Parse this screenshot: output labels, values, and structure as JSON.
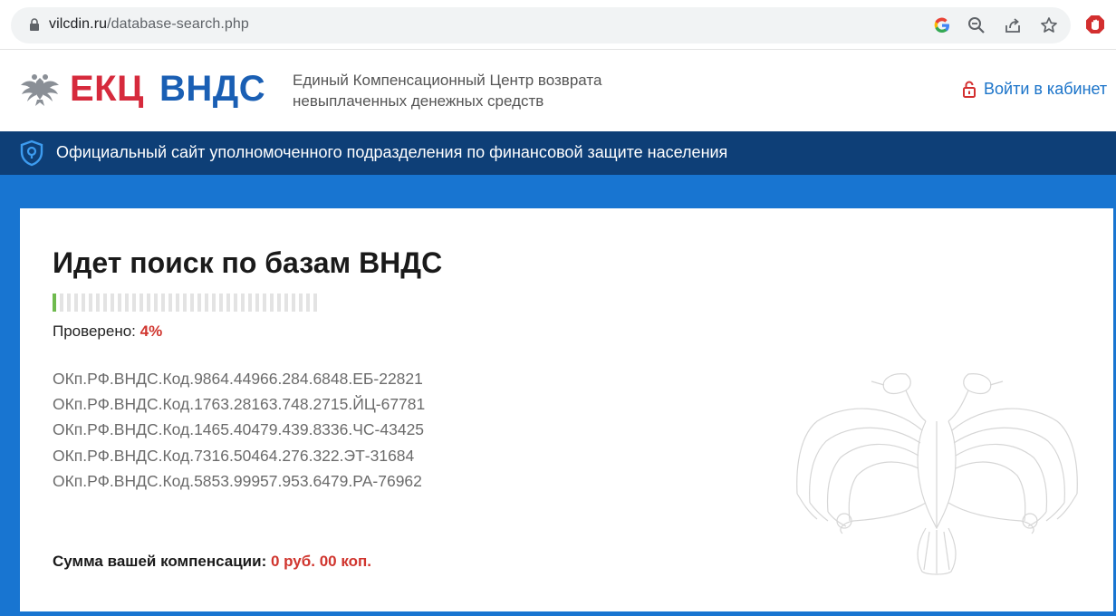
{
  "browser": {
    "url_host": "vilcdin.ru",
    "url_path": "/database-search.php",
    "icons": [
      "lock-icon",
      "google-icon",
      "zoom-icon",
      "share-icon",
      "star-icon",
      "extension-icon"
    ]
  },
  "header": {
    "brand_red": "ЕКЦ",
    "brand_blue": "ВНДС",
    "tagline_line1": "Единый Компенсационный Центр возврата",
    "tagline_line2": "невыплаченных денежных средств",
    "login_label": "Войти в кабинет"
  },
  "banner": {
    "text": "Официальный сайт уполномоченного подразделения по финансовой защите населения"
  },
  "search": {
    "title": "Идет поиск по базам ВНДС",
    "checked_label": "Проверено:",
    "checked_value": "4%",
    "progress_fraction": 0.04,
    "codes": [
      "ОКп.РФ.ВНДС.Код.9864.44966.284.6848.ЕБ-22821",
      "ОКп.РФ.ВНДС.Код.1763.28163.748.2715.ЙЦ-67781",
      "ОКп.РФ.ВНДС.Код.1465.40479.439.8336.ЧС-43425",
      "ОКп.РФ.ВНДС.Код.7316.50464.276.322.ЭТ-31684",
      "ОКп.РФ.ВНДС.Код.5853.99957.953.6479.РА-76962"
    ],
    "sum_label": "Сумма вашей компенсации:",
    "sum_value": "0 руб. 00 коп."
  },
  "colors": {
    "brand_red": "#d62a3c",
    "brand_blue": "#1a5fb4",
    "banner": "#0e3f77",
    "page_blue": "#1875d1",
    "progress_done": "#6fba4e",
    "accent_red": "#d0352e"
  }
}
